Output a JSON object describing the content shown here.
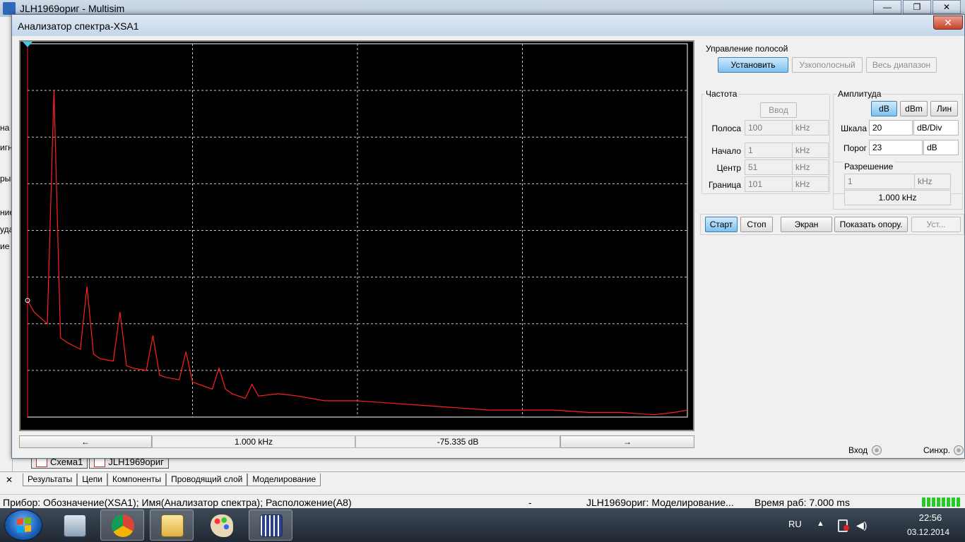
{
  "app": {
    "title": "JLH1969ориг - Multisim",
    "controls": [
      "—",
      "❐",
      "✕"
    ],
    "left_fragments": [
      "на",
      "игн",
      "ры",
      "ние",
      "уда",
      "ие"
    ],
    "sheet_tabs": [
      "Схема1",
      "JLH1969ориг"
    ],
    "bottom_close": "✕",
    "bottom_tabs": [
      "Результаты",
      "Цепи",
      "Компоненты",
      "Проводящий слой",
      "Моделирование"
    ],
    "status": {
      "device": "Прибор: Обозначение(XSA1); Имя(Анализатор спектра); Расположение(A8)",
      "dash": "-",
      "state": "JLH1969ориг: Моделирование...",
      "time": "Время раб: 7.000 ms"
    }
  },
  "taskbar": {
    "apps": [
      "start-menu",
      "calculator",
      "chrome",
      "explorer",
      "paint",
      "multisim"
    ],
    "tray": {
      "lang": "RU",
      "up": "▲",
      "volume": "◀)",
      "time": "22:56",
      "date": "03.12.2014"
    }
  },
  "analyzer": {
    "title": "Анализатор спектра-XSA1",
    "close": "✕",
    "nav": {
      "left_arrow": "←",
      "freq_readout": "1.000 kHz",
      "amp_readout": "-75.335  dB",
      "right_arrow": "→"
    },
    "band_control": {
      "label": "Управление полосой",
      "set": "Установить",
      "narrow": "Узкополосный",
      "full": "Весь диапазон"
    },
    "frequency": {
      "label": "Частота",
      "enter": "Ввод",
      "rows": [
        {
          "label": "Полоса",
          "value": "100",
          "unit": "kHz"
        },
        {
          "label": "Начало",
          "value": "1",
          "unit": "kHz"
        },
        {
          "label": "Центр",
          "value": "51",
          "unit": "kHz"
        },
        {
          "label": "Граница",
          "value": "101",
          "unit": "kHz"
        }
      ]
    },
    "amplitude": {
      "label": "Амплитуда",
      "modes": [
        "dB",
        "dBm",
        "Лин"
      ],
      "scale_label": "Шкала",
      "scale_value": "20",
      "scale_unit": "dB/Div",
      "threshold_label": "Порог",
      "threshold_value": "23",
      "threshold_unit": "dB"
    },
    "resolution": {
      "label": "Разрешение",
      "value": "1",
      "unit": "kHz",
      "display": "1.000 kHz"
    },
    "buttons": {
      "start": "Старт",
      "stop": "Стоп",
      "screen": "Экран",
      "show_ref": "Показать опору.",
      "settings": "Уст..."
    },
    "connectors": {
      "input": "Вход",
      "sync": "Синхр."
    },
    "colors": {
      "trace": "#ff2020",
      "grid": "#c8c8c8",
      "screen_bg": "#000000",
      "pressed": "#7ec1ef"
    }
  },
  "chart_data": {
    "type": "line",
    "xlim": [
      1,
      101
    ],
    "ylim": [
      -140,
      20
    ],
    "grid": true,
    "x": [
      1,
      2,
      4,
      5,
      6,
      7,
      9,
      10,
      11,
      12,
      14,
      15,
      16,
      17,
      19,
      20,
      21,
      22,
      24,
      25,
      26,
      27,
      29,
      30,
      31,
      32,
      34,
      35,
      36,
      39,
      42,
      46,
      51,
      56,
      61,
      66,
      71,
      76,
      81,
      86,
      91,
      96,
      99,
      101
    ],
    "y": [
      -90,
      -95,
      -100,
      0,
      -106,
      -108,
      -111,
      -84,
      -113,
      -115,
      -116,
      -95,
      -118,
      -119,
      -120,
      -105,
      -122,
      -123,
      -124,
      -112,
      -125,
      -126,
      -128,
      -119,
      -128,
      -130,
      -132,
      -126,
      -131,
      -130,
      -131,
      -133,
      -133,
      -134,
      -135,
      -136,
      -137,
      -137,
      -137,
      -138,
      -138,
      -139,
      -138,
      -137
    ]
  }
}
